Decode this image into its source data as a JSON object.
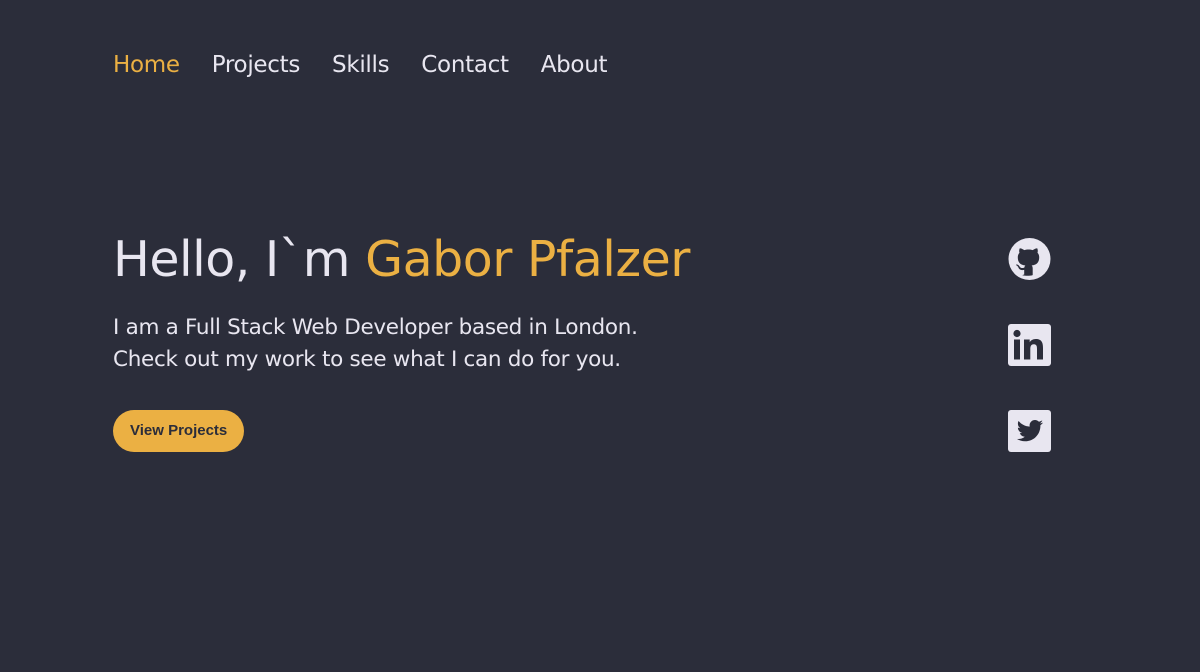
{
  "nav": {
    "items": [
      {
        "label": "Home",
        "active": true
      },
      {
        "label": "Projects",
        "active": false
      },
      {
        "label": "Skills",
        "active": false
      },
      {
        "label": "Contact",
        "active": false
      },
      {
        "label": "About",
        "active": false
      }
    ]
  },
  "hero": {
    "greeting": "Hello, I`m ",
    "name": "Gabor Pfalzer",
    "intro_line1": "I am a Full Stack Web Developer based in London.",
    "intro_line2": "Check out my work to see what I can do for you.",
    "cta_label": "View Projects"
  },
  "social": {
    "icons": [
      "github-icon",
      "linkedin-icon",
      "twitter-icon"
    ]
  },
  "colors": {
    "background": "#2b2d3a",
    "accent": "#ebb043",
    "text": "#e8e6f0"
  }
}
